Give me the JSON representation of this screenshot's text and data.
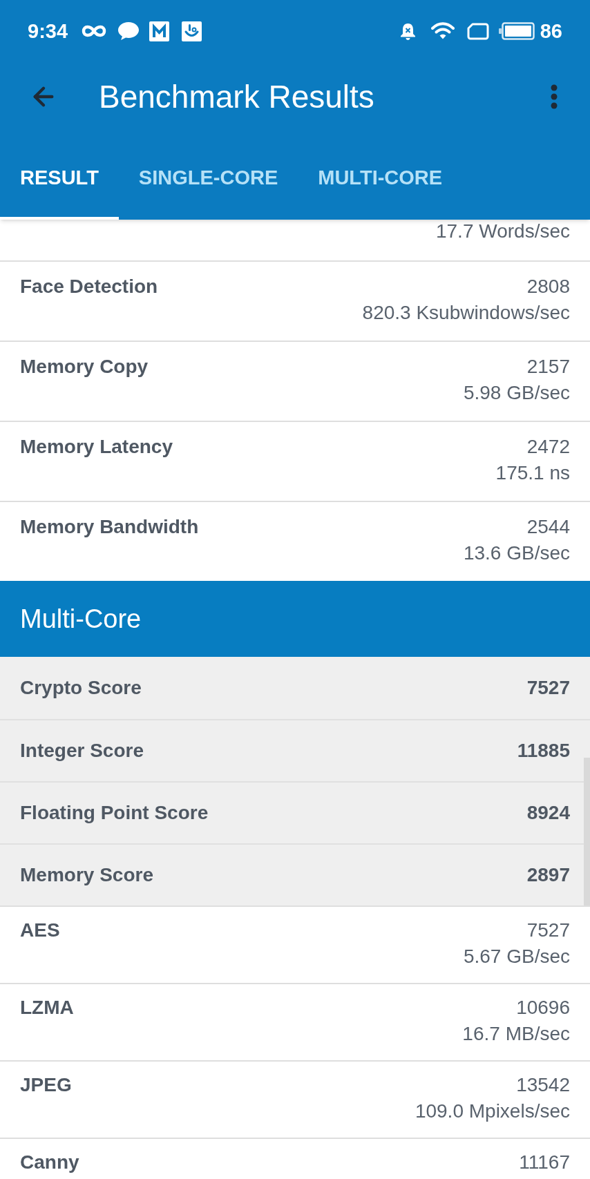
{
  "status_bar": {
    "time": "9:34",
    "battery": "86"
  },
  "app_bar": {
    "title": "Benchmark Results"
  },
  "tabs": [
    {
      "label": "RESULT",
      "selected": true
    },
    {
      "label": "SINGLE-CORE",
      "selected": false
    },
    {
      "label": "MULTI-CORE",
      "selected": false
    }
  ],
  "upper_results": [
    {
      "rate": "17.7 Words/sec"
    },
    {
      "name": "Face Detection",
      "score": "2808",
      "rate": "820.3 Ksubwindows/sec"
    },
    {
      "name": "Memory Copy",
      "score": "2157",
      "rate": "5.98 GB/sec"
    },
    {
      "name": "Memory Latency",
      "score": "2472",
      "rate": "175.1 ns"
    },
    {
      "name": "Memory Bandwidth",
      "score": "2544",
      "rate": "13.6 GB/sec"
    }
  ],
  "multi_core": {
    "title": "Multi-Core",
    "scores": [
      {
        "name": "Crypto Score",
        "score": "7527"
      },
      {
        "name": "Integer Score",
        "score": "11885"
      },
      {
        "name": "Floating Point Score",
        "score": "8924"
      },
      {
        "name": "Memory Score",
        "score": "2897"
      }
    ],
    "results": [
      {
        "name": "AES",
        "score": "7527",
        "rate": "5.67 GB/sec"
      },
      {
        "name": "LZMA",
        "score": "10696",
        "rate": "16.7 MB/sec"
      },
      {
        "name": "JPEG",
        "score": "13542",
        "rate": "109.0 Mpixels/sec"
      },
      {
        "name": "Canny",
        "score": "11167"
      }
    ]
  }
}
